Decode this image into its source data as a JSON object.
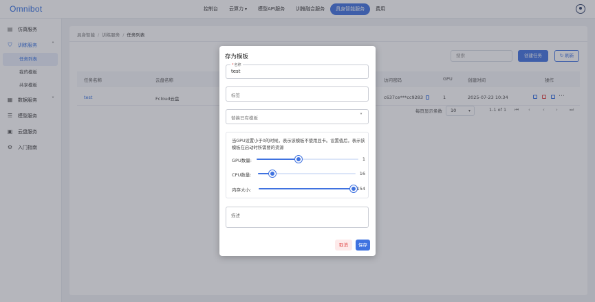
{
  "app": {
    "logo": "Omnibot"
  },
  "topnav": {
    "items": [
      {
        "label": "控制台"
      },
      {
        "label": "云算力"
      },
      {
        "label": "模型API服务"
      },
      {
        "label": "训推融合服务"
      },
      {
        "label": "具身智能服务"
      },
      {
        "label": "费用"
      }
    ],
    "active_index": 4
  },
  "sidebar": {
    "items": [
      {
        "label": "仿真服务",
        "icon": "document-icon"
      },
      {
        "label": "训练服务",
        "icon": "shield-icon"
      },
      {
        "label": "数据服务",
        "icon": "database-icon"
      },
      {
        "label": "模型服务",
        "icon": "server-icon"
      },
      {
        "label": "云盘服务",
        "icon": "cloud-drive-icon"
      },
      {
        "label": "入门指南",
        "icon": "gear-icon"
      }
    ],
    "subitems": [
      {
        "label": "任务列表"
      },
      {
        "label": "我的模板"
      },
      {
        "label": "共享模板"
      }
    ]
  },
  "breadcrumb": {
    "items": [
      "具身智能",
      "训练服务",
      "任务列表"
    ]
  },
  "toolbar": {
    "search_placeholder": "搜索",
    "create_label": "创建任务",
    "refresh_label": "刷新"
  },
  "table": {
    "headers": [
      "任务名称",
      "云盘名称",
      "访问密码",
      "GPU",
      "创建时间",
      "操作"
    ],
    "rows": [
      {
        "name": "test",
        "disk": "Fcloud云盘",
        "password": "c637ce***cc9283",
        "gpu": "1",
        "created": "2025-07-23 10:34"
      }
    ]
  },
  "pagination": {
    "per_page_label": "每页显示条数",
    "per_page": "10",
    "range": "1-1 of 1"
  },
  "modal": {
    "title": "存为模板",
    "name_label": "名称",
    "name_value": "test",
    "tag_placeholder": "标签",
    "replace_placeholder": "替换已有模板",
    "note": "当GPU设置小于0的时候，表示该模板不使用显卡。设置值后，表示该模板在启动时所需要的资源",
    "sliders": [
      {
        "label": "GPU数量:",
        "value": "1",
        "fraction": 0.41
      },
      {
        "label": "CPU数量:",
        "value": "16",
        "fraction": 0.15
      },
      {
        "label": "内存大小:",
        "value": "154",
        "fraction": 1.0
      }
    ],
    "desc_placeholder": "描述",
    "cancel_label": "取消",
    "save_label": "保存"
  },
  "colors": {
    "primary": "#3f72e0",
    "danger": "#e04a4a",
    "overlay": "#3c4050"
  }
}
